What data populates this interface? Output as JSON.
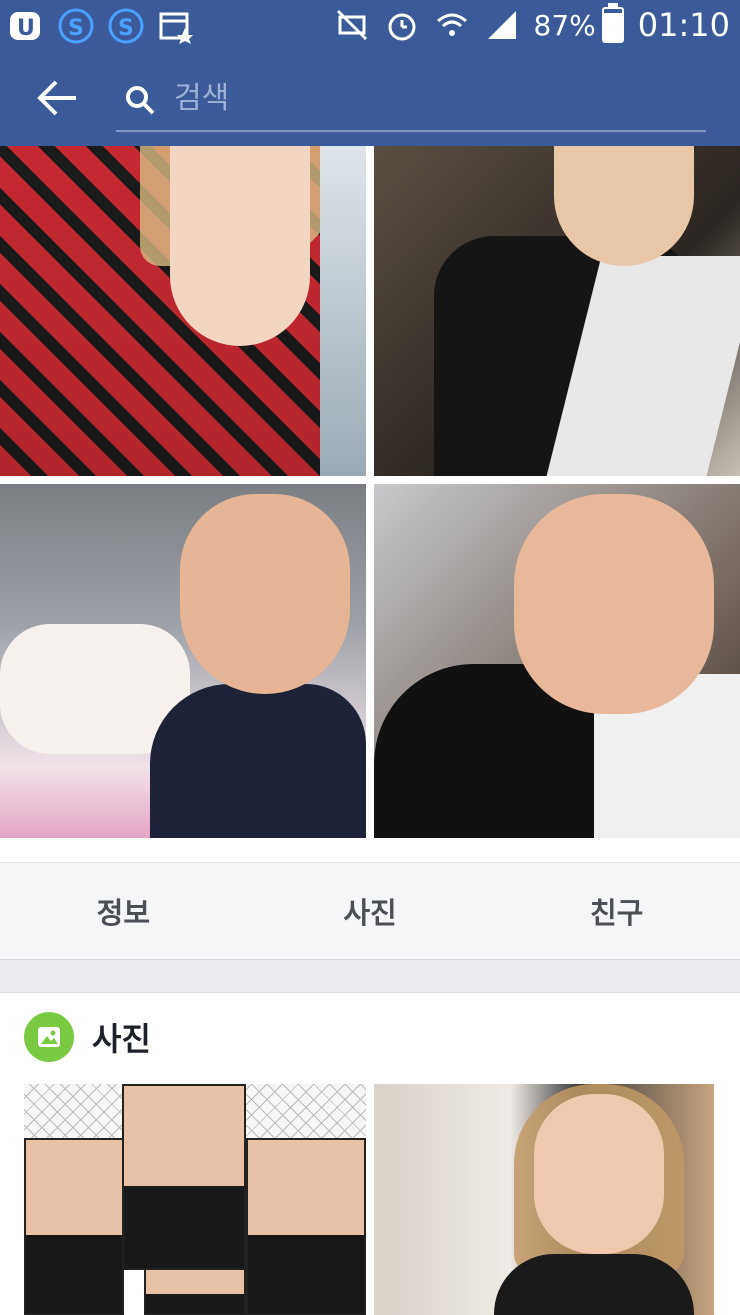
{
  "status_bar": {
    "left_icons": [
      "u-plus-icon",
      "s-app-icon",
      "s-app-icon",
      "calendar-star-icon"
    ],
    "battery_percent": "87%",
    "battery_level": 0.87,
    "time": "01:10",
    "right_icons": [
      "mute-icon",
      "alarm-icon",
      "wifi-icon",
      "signal-icon",
      "battery-icon"
    ]
  },
  "app_bar": {
    "back_icon": "back-arrow-icon",
    "search_placeholder": "검색"
  },
  "profile_photos": [
    {
      "name": "profile-photo-1"
    },
    {
      "name": "profile-photo-2"
    },
    {
      "name": "profile-photo-3"
    },
    {
      "name": "profile-photo-4"
    }
  ],
  "tabs": [
    {
      "label": "정보"
    },
    {
      "label": "사진"
    },
    {
      "label": "친구"
    }
  ],
  "photos_section": {
    "title": "사진",
    "icon": "photo-icon",
    "icon_color": "#7ac943"
  },
  "colors": {
    "brand": "#3b5a9a",
    "tab_text": "#4b4f56"
  }
}
